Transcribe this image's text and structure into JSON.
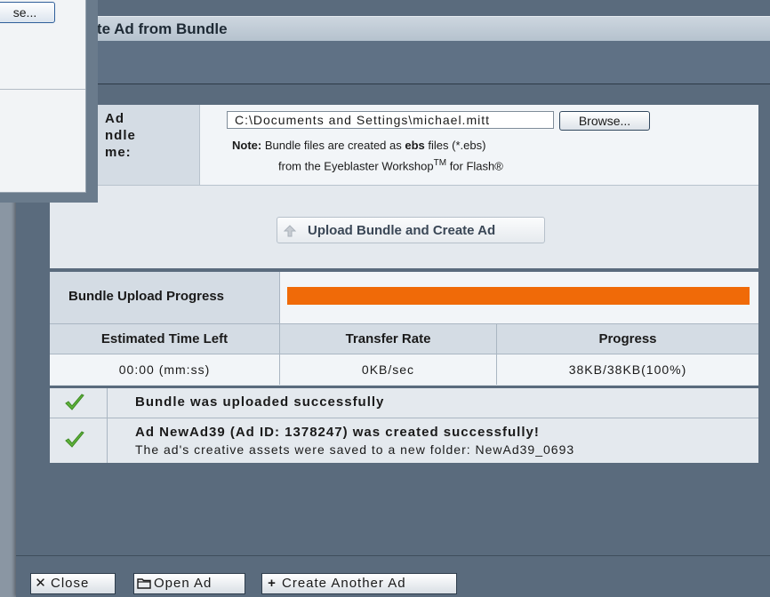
{
  "window": {
    "title": "eate Ad from Bundle"
  },
  "form": {
    "label": "Ad\nndle\nme:",
    "path_value": "C:\\Documents and Settings\\michael.mitt",
    "browse_label": "Browse...",
    "note_prefix": "Note:",
    "note_line1_a": " Bundle files are created as ",
    "note_line1_bold": "ebs",
    "note_line1_b": " files (*.ebs)",
    "note_line2_a": "from the Eyeblaster Workshop",
    "note_line2_sup": "TM",
    "note_line2_b": " for Flash®",
    "upload_label": "Upload Bundle and Create Ad",
    "upload_icon": "upload-arrow-icon"
  },
  "progress": {
    "label": "Bundle Upload Progress",
    "fraction": 1.0,
    "bar_color": "#f06a08",
    "columns": [
      "Estimated Time Left",
      "Transfer Rate",
      "Progress"
    ],
    "values": [
      "00:00 (mm:ss)",
      "0KB/sec",
      "38KB/38KB(100%)"
    ]
  },
  "messages": [
    {
      "icon": "checkmark-icon",
      "text": "Bundle was uploaded successfully",
      "sub": ""
    },
    {
      "icon": "checkmark-icon",
      "text": "Ad NewAd39 (Ad ID: 1378247) was created successfully!",
      "sub": "The ad's creative assets were saved to a new folder: NewAd39_0693"
    }
  ],
  "footer": {
    "close_label": "Close",
    "open_label": "Open Ad",
    "create_another_label": "Create Another Ad"
  },
  "background_window": {
    "browse_label": "se..."
  },
  "colors": {
    "accent_orange": "#f06a08",
    "check_green": "#5fb33a"
  }
}
